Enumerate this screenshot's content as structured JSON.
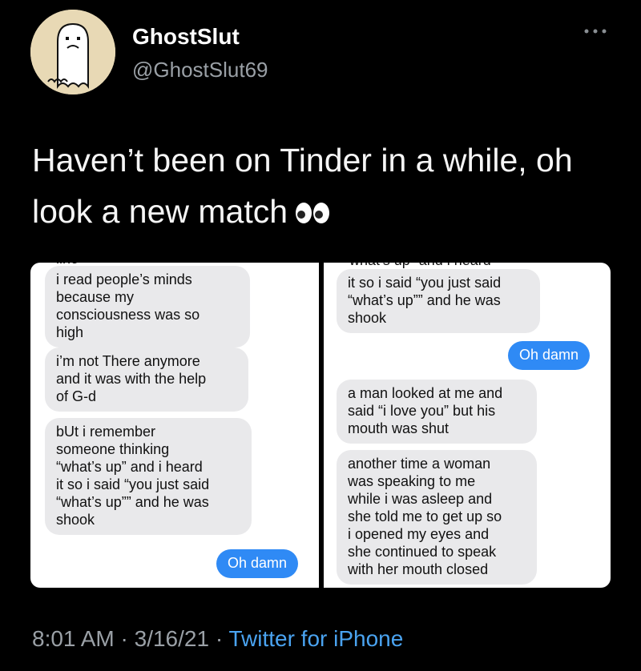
{
  "user": {
    "name": "GhostSlut",
    "handle": "@GhostSlut69"
  },
  "tweet": {
    "text": "Haven’t been on Tinder in a while, oh look a new match",
    "emoji_icon": "eyes-icon"
  },
  "more_icon": "ellipsis-icon",
  "left_panel": {
    "clipped_top": "line",
    "bubbles": [
      {
        "text": "i read people’s minds\nbecause my\nconsciousness was so\nhigh",
        "from": "them"
      },
      {
        "text": "i’m not There anymore\nand it was with the help\nof G-d",
        "from": "them"
      },
      {
        "text": "bUt i remember\nsomeone thinking\n“what’s up” and i heard\nit so i said “you just said\n“what’s up”” and he was\nshook",
        "from": "them"
      },
      {
        "text": "Oh damn",
        "from": "me"
      }
    ]
  },
  "right_panel": {
    "clipped_top": "what’s up” and i heard",
    "bubbles": [
      {
        "text": "it so i said “you just said\n“what’s up”” and he was\nshook",
        "from": "them"
      },
      {
        "text": "Oh damn",
        "from": "me"
      },
      {
        "text": "a man looked at me and\nsaid “i love you” but his\nmouth was shut",
        "from": "them"
      },
      {
        "text": "another time a woman\nwas speaking to me\nwhile i was asleep and\nshe told me to get up so\ni opened my eyes and\nshe continued to speak\nwith her mouth closed",
        "from": "them"
      }
    ]
  },
  "footer": {
    "time": "8:01 AM",
    "sep1": " · ",
    "date": "3/16/21",
    "sep2": " · ",
    "source": "Twitter for iPhone"
  }
}
